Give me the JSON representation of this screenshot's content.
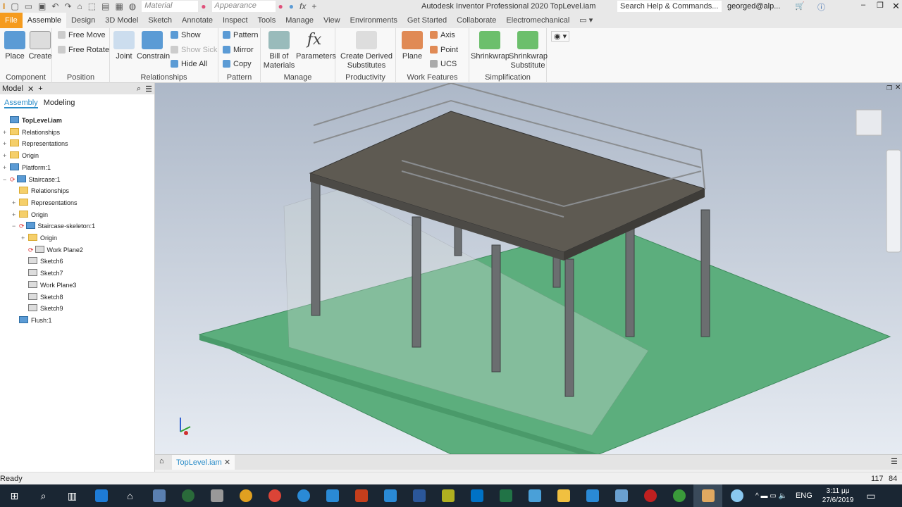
{
  "titlebar": {
    "material": "Material",
    "appearance": "Appearance",
    "title": "Autodesk Inventor Professional 2020   TopLevel.iam",
    "search_placeholder": "Search Help & Commands...",
    "user": "georged@alp..."
  },
  "tabs": [
    "File",
    "Assemble",
    "Design",
    "3D Model",
    "Sketch",
    "Annotate",
    "Inspect",
    "Tools",
    "Manage",
    "View",
    "Environments",
    "Get Started",
    "Collaborate",
    "Electromechanical"
  ],
  "ribbon": {
    "component": {
      "label": "Component",
      "place": "Place",
      "create": "Create"
    },
    "position": {
      "label": "Position",
      "free_move": "Free Move",
      "free_rotate": "Free Rotate"
    },
    "relationships": {
      "label": "Relationships",
      "joint": "Joint",
      "constrain": "Constrain",
      "show": "Show",
      "show_sick": "Show Sick",
      "hide_all": "Hide All"
    },
    "pattern": {
      "label": "Pattern",
      "pattern": "Pattern",
      "mirror": "Mirror",
      "copy": "Copy"
    },
    "manage": {
      "label": "Manage",
      "bom": "Bill of Materials",
      "parameters": "Parameters"
    },
    "productivity": {
      "label": "Productivity",
      "create_derived": "Create Derived Substitutes"
    },
    "work_features": {
      "label": "Work Features",
      "plane": "Plane",
      "axis": "Axis",
      "point": "Point",
      "ucs": "UCS"
    },
    "simplification": {
      "label": "Simplification",
      "shrinkwrap": "Shrinkwrap",
      "shrinkwrap_sub": "Shrinkwrap Substitute"
    }
  },
  "browser": {
    "title": "Model",
    "tab_assembly": "Assembly",
    "tab_modeling": "Modeling",
    "tree": [
      {
        "label": "TopLevel.iam",
        "level": 0,
        "icon": "assembly",
        "pm": ""
      },
      {
        "label": "Relationships",
        "level": 0,
        "icon": "folder",
        "pm": "+"
      },
      {
        "label": "Representations",
        "level": 0,
        "icon": "folder",
        "pm": "+"
      },
      {
        "label": "Origin",
        "level": 0,
        "icon": "folder",
        "pm": "+"
      },
      {
        "label": "Platform:1",
        "level": 0,
        "icon": "part",
        "pm": "+"
      },
      {
        "label": "Staircase:1",
        "level": 0,
        "icon": "assembly",
        "pm": "−",
        "sync": true
      },
      {
        "label": "Relationships",
        "level": 1,
        "icon": "folder",
        "pm": ""
      },
      {
        "label": "Representations",
        "level": 1,
        "icon": "folder",
        "pm": "+"
      },
      {
        "label": "Origin",
        "level": 1,
        "icon": "folder",
        "pm": "+"
      },
      {
        "label": "Staircase-skeleton:1",
        "level": 1,
        "icon": "part",
        "pm": "−",
        "sync": true
      },
      {
        "label": "Origin",
        "level": 2,
        "icon": "folder",
        "pm": "+"
      },
      {
        "label": "Work Plane2",
        "level": 2,
        "icon": "plane",
        "pm": "",
        "sync": true
      },
      {
        "label": "Sketch6",
        "level": 2,
        "icon": "sketch",
        "pm": ""
      },
      {
        "label": "Sketch7",
        "level": 2,
        "icon": "sketch",
        "pm": ""
      },
      {
        "label": "Work Plane3",
        "level": 2,
        "icon": "plane",
        "pm": ""
      },
      {
        "label": "Sketch8",
        "level": 2,
        "icon": "sketch",
        "pm": ""
      },
      {
        "label": "Sketch9",
        "level": 2,
        "icon": "sketch",
        "pm": ""
      },
      {
        "label": "Flush:1",
        "level": 1,
        "icon": "constraint",
        "pm": ""
      }
    ]
  },
  "doc_tab": "TopLevel.iam",
  "status": {
    "text": "Ready",
    "n1": "117",
    "n2": "84"
  },
  "taskbar": {
    "lang": "ENG",
    "time": "3:11 μμ",
    "date": "27/6/2019"
  }
}
